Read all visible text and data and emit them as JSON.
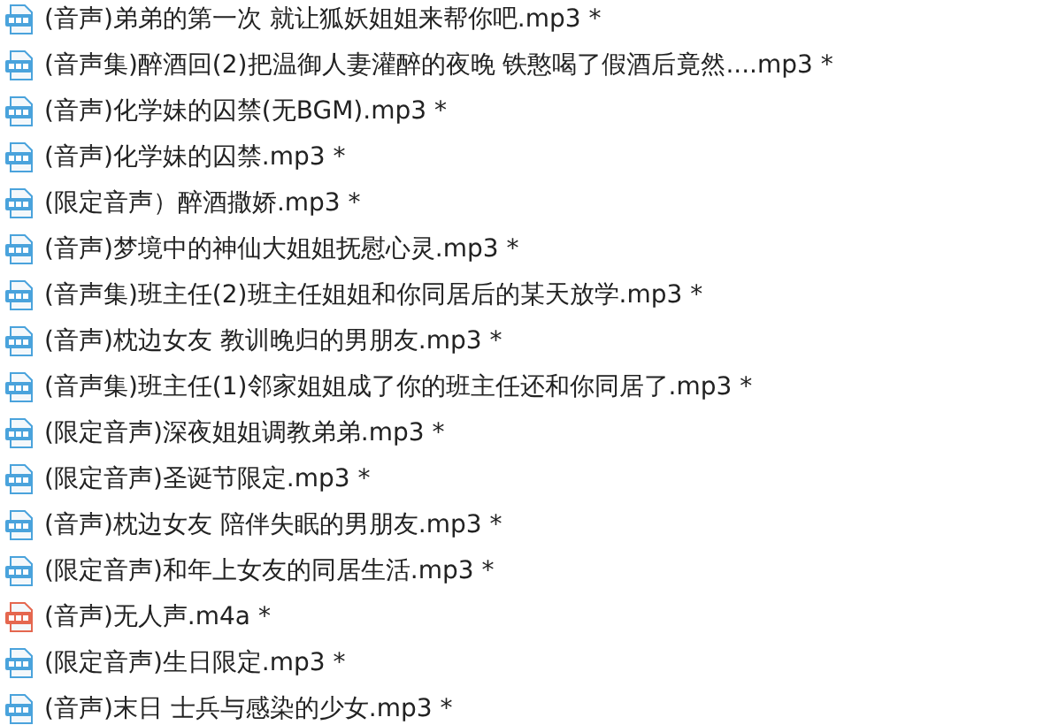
{
  "files": [
    {
      "name": "(音声)弟弟的第一次 就让狐妖姐姐来帮你吧.mp3 *",
      "kind": "mp3"
    },
    {
      "name": "(音声集)醉酒回(2)把温御人妻灌醉的夜晚 铁憨喝了假酒后竟然....mp3 *",
      "kind": "mp3"
    },
    {
      "name": "(音声)化学妹的囚禁(无BGM).mp3 *",
      "kind": "mp3"
    },
    {
      "name": "(音声)化学妹的囚禁.mp3 *",
      "kind": "mp3"
    },
    {
      "name": "(限定音声）醉酒撒娇.mp3 *",
      "kind": "mp3"
    },
    {
      "name": "(音声)梦境中的神仙大姐姐抚慰心灵.mp3 *",
      "kind": "mp3"
    },
    {
      "name": "(音声集)班主任(2)班主任姐姐和你同居后的某天放学.mp3 *",
      "kind": "mp3"
    },
    {
      "name": "(音声)枕边女友 教训晚归的男朋友.mp3 *",
      "kind": "mp3"
    },
    {
      "name": "(音声集)班主任(1)邻家姐姐成了你的班主任还和你同居了.mp3 *",
      "kind": "mp3"
    },
    {
      "name": "(限定音声)深夜姐姐调教弟弟.mp3 *",
      "kind": "mp3"
    },
    {
      "name": "(限定音声)圣诞节限定.mp3 *",
      "kind": "mp3"
    },
    {
      "name": "(音声)枕边女友 陪伴失眠的男朋友.mp3 *",
      "kind": "mp3"
    },
    {
      "name": "(限定音声)和年上女友的同居生活.mp3 *",
      "kind": "mp3"
    },
    {
      "name": "(音声)无人声.m4a *",
      "kind": "m4a"
    },
    {
      "name": "(限定音声)生日限定.mp3 *",
      "kind": "mp3"
    },
    {
      "name": "(音声)末日 士兵与感染的少女.mp3 *",
      "kind": "mp3"
    }
  ]
}
